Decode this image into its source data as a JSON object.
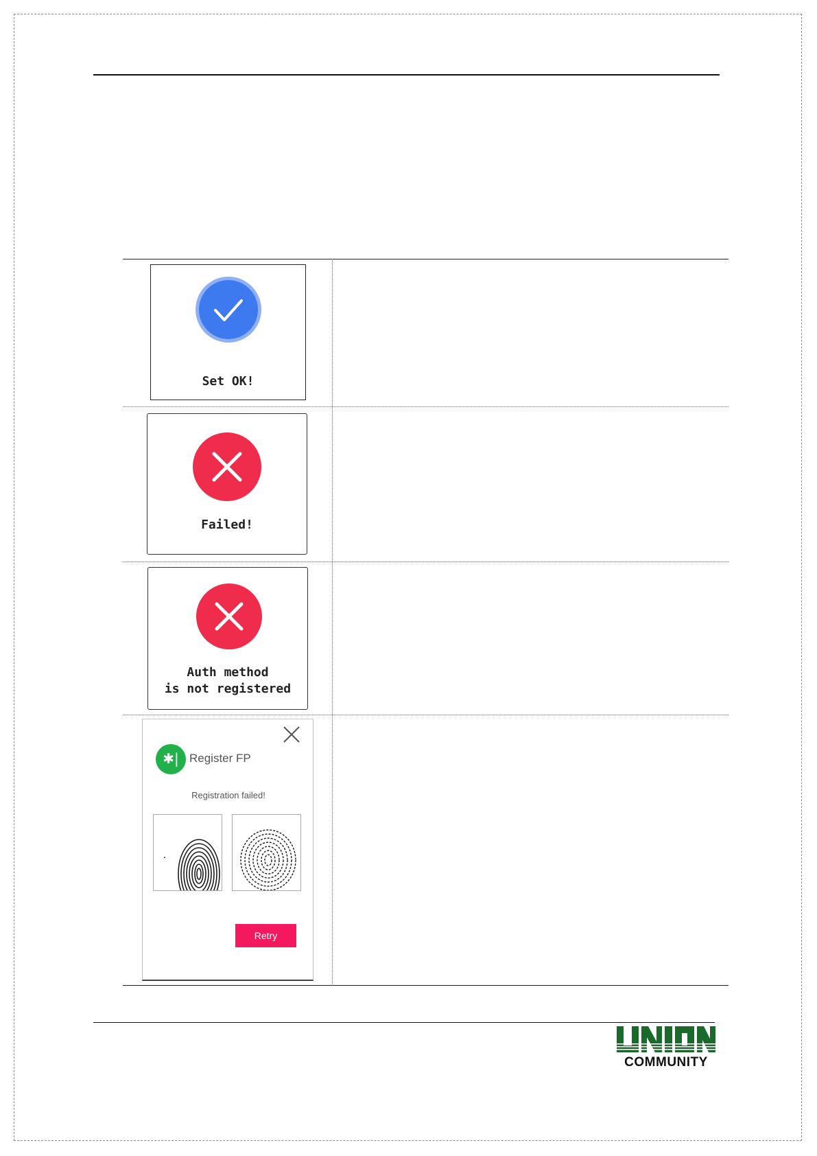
{
  "screens": {
    "set_ok": {
      "label": "Set OK!"
    },
    "failed": {
      "label": "Failed!"
    },
    "auth_not_registered": {
      "label": "Auth method\nis not registered"
    },
    "register_fp": {
      "title": "Register FP",
      "status": "Registration failed!",
      "retry_label": "Retry"
    }
  },
  "icons": {
    "success": "checkmark-icon",
    "error": "x-icon",
    "close": "close-icon",
    "fingerprint_badge": "fingerprint-icon"
  },
  "colors": {
    "success_blue": "#3d7af0",
    "error_red": "#ef2c4b",
    "badge_green": "#22b04b",
    "retry_pink": "#f4185f",
    "logo_green": "#1a6a2c"
  },
  "logo": {
    "brand": "UNION",
    "sub": "COMMUNITY"
  }
}
